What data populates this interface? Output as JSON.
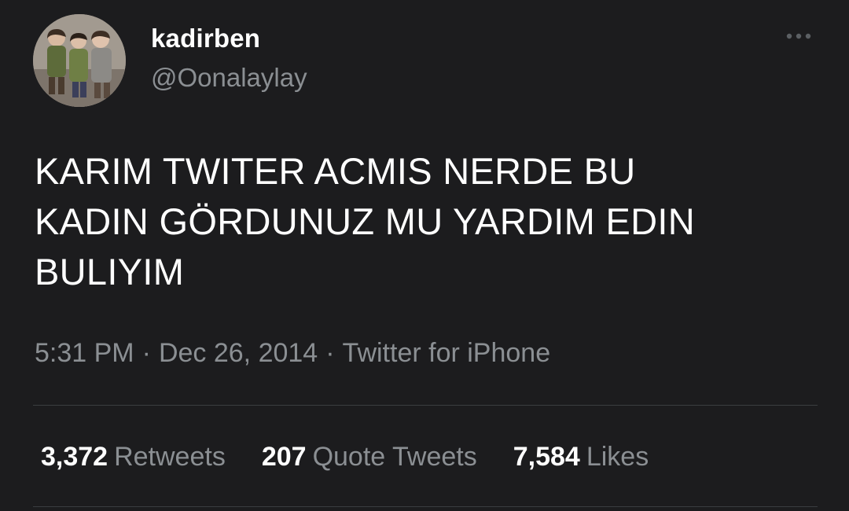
{
  "user": {
    "display_name": "kadirben",
    "handle": "@Oonalaylay"
  },
  "tweet": {
    "text": "KARIM TWITER ACMIS NERDE BU\nKADIN GÖRDUNUZ MU YARDIM EDIN\nBULIYIM",
    "time": "5:31 PM",
    "date": "Dec 26, 2014",
    "source": "Twitter for iPhone",
    "separator": "·"
  },
  "stats": {
    "retweets_count": "3,372",
    "retweets_label": "Retweets",
    "quotes_count": "207",
    "quotes_label": "Quote Tweets",
    "likes_count": "7,584",
    "likes_label": "Likes"
  },
  "icons": {
    "more": "more-horizontal-icon"
  },
  "colors": {
    "background": "#1c1c1e",
    "primary_text": "#ffffff",
    "secondary_text": "#8b8f93",
    "divider": "#3a3d40"
  }
}
